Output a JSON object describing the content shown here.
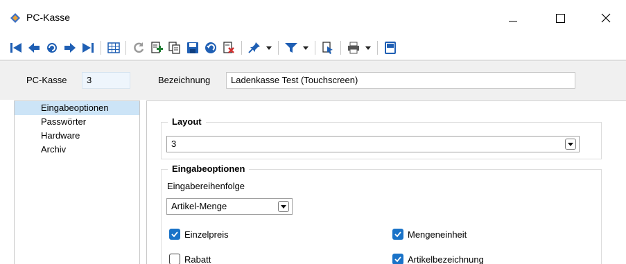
{
  "window": {
    "title": "PC-Kasse"
  },
  "toolbar": {
    "buttons": [
      {
        "icon": "first-record-icon",
        "color": "#1f5fb4"
      },
      {
        "icon": "previous-record-icon",
        "color": "#1f5fb4"
      },
      {
        "icon": "search-record-icon",
        "color": "#1f5fb4"
      },
      {
        "icon": "next-record-icon",
        "color": "#1f5fb4"
      },
      {
        "icon": "last-record-icon",
        "color": "#1f5fb4"
      },
      {
        "icon": "table-view-icon",
        "color": "#1f5fb4"
      },
      {
        "icon": "refresh-icon",
        "color": "#9a9a9a"
      },
      {
        "icon": "new-record-icon",
        "color": "#1e7d32"
      },
      {
        "icon": "copy-record-icon",
        "color": "#333333"
      },
      {
        "icon": "save-icon",
        "color": "#1f5fb4"
      },
      {
        "icon": "undo-icon",
        "color": "#1f5fb4"
      },
      {
        "icon": "delete-record-icon",
        "color": "#d32f2f"
      },
      {
        "icon": "pin-icon",
        "color": "#1f5fb4"
      },
      {
        "icon": "filter-icon",
        "color": "#1f5fb4"
      },
      {
        "icon": "document-selection-icon",
        "color": "#1f5fb4"
      },
      {
        "icon": "print-icon",
        "color": "#555555"
      },
      {
        "icon": "notes-icon",
        "color": "#1f5fb4"
      }
    ]
  },
  "header": {
    "kasse_label": "PC-Kasse",
    "kasse_value": "3",
    "bezeichnung_label": "Bezeichnung",
    "bezeichnung_value": "Ladenkasse Test (Touchscreen)"
  },
  "nav": {
    "items": [
      {
        "label": "Eingabeoptionen",
        "selected": true
      },
      {
        "label": "Passwörter",
        "selected": false
      },
      {
        "label": "Hardware",
        "selected": false
      },
      {
        "label": "Archiv",
        "selected": false
      }
    ]
  },
  "layout_group": {
    "title": "Layout",
    "value": "3"
  },
  "options_group": {
    "title": "Eingabeoptionen",
    "order_label": "Eingabereihenfolge",
    "order_value": "Artikel-Menge",
    "checkboxes": [
      {
        "label": "Einzelpreis",
        "checked": true
      },
      {
        "label": "Mengeneinheit",
        "checked": true
      },
      {
        "label": "Rabatt",
        "checked": false
      },
      {
        "label": "Artikelbezeichnung",
        "checked": true
      }
    ]
  },
  "colors": {
    "accent": "#1a73c8",
    "selection": "#cce4f7",
    "panel_bg": "#f0f0f0"
  }
}
